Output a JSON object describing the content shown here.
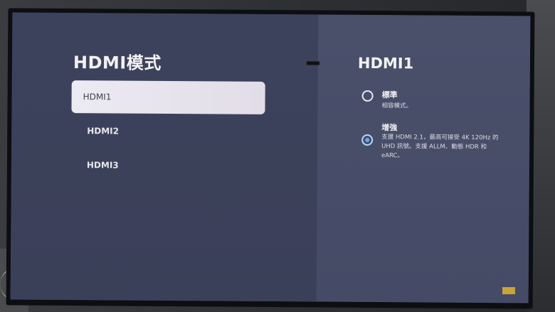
{
  "left_panel": {
    "title": "HDMI模式",
    "items": [
      {
        "label": "HDMI1",
        "selected": true
      },
      {
        "label": "HDMI2",
        "selected": false
      },
      {
        "label": "HDMI3",
        "selected": false
      }
    ]
  },
  "right_panel": {
    "title": "HDMI1",
    "options": [
      {
        "label": "標準",
        "description": "相容模式。",
        "selected": false
      },
      {
        "label": "增強",
        "description": "支援 HDMI 2.1，最高可接受 4K 120Hz 的 UHD 訊號。支援 ALLM、動態 HDR 和 eARC。",
        "selected": true
      }
    ]
  },
  "colors": {
    "accent": "#6aa8f7",
    "panel_left": "#3d425c",
    "panel_right": "#4a506a",
    "selected_item_bg": "#eceaf2"
  }
}
